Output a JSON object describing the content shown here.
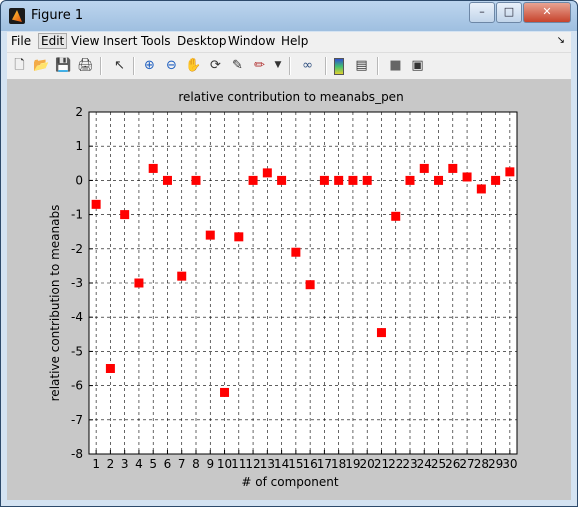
{
  "window": {
    "title": "Figure 1"
  },
  "menu": [
    "File",
    "Edit",
    "View",
    "Insert",
    "Tools",
    "Desktop",
    "Window",
    "Help"
  ],
  "toolbar": {
    "icons": [
      "new-figure-icon",
      "open-file-icon",
      "save-icon",
      "print-icon",
      "select-arrow-icon",
      "zoom-in-icon",
      "zoom-out-icon",
      "pan-hand-icon",
      "rotate-3d-icon",
      "data-cursor-icon",
      "brush-icon",
      "dropdown-arrow-icon",
      "link-plot-icon",
      "colorbar-icon",
      "legend-icon",
      "hide-plot-tools-icon",
      "show-plot-tools-icon"
    ]
  },
  "chart_data": {
    "type": "scatter",
    "title": "relative contribution to meanabs_pen",
    "xlabel": "# of component",
    "ylabel": "relative contribution to meanabs",
    "xlim": [
      0.5,
      30.5
    ],
    "ylim": [
      -8,
      2
    ],
    "yticks": [
      2,
      1,
      0,
      -1,
      -2,
      -3,
      -4,
      -5,
      -6,
      -7,
      -8
    ],
    "xticks": [
      1,
      2,
      3,
      4,
      5,
      6,
      7,
      8,
      9,
      10,
      11,
      12,
      13,
      14,
      15,
      16,
      17,
      18,
      19,
      20,
      21,
      22,
      23,
      24,
      25,
      26,
      27,
      28,
      29,
      30
    ],
    "grid": true,
    "marker": "square",
    "marker_color": "#ff0000",
    "x": [
      1,
      2,
      3,
      4,
      5,
      6,
      7,
      8,
      9,
      10,
      11,
      12,
      13,
      14,
      15,
      16,
      17,
      18,
      19,
      20,
      21,
      22,
      23,
      24,
      25,
      26,
      27,
      28,
      29,
      30
    ],
    "y": [
      -0.7,
      -5.5,
      -1.0,
      -3.0,
      0.35,
      0.0,
      -2.8,
      0.0,
      -1.6,
      -6.2,
      -1.65,
      0.0,
      0.22,
      0.0,
      -2.1,
      -3.05,
      0.0,
      0.0,
      0.0,
      0.0,
      -4.45,
      -1.05,
      0.0,
      0.35,
      0.0,
      0.35,
      0.1,
      -0.25,
      0.0,
      0.25
    ]
  }
}
